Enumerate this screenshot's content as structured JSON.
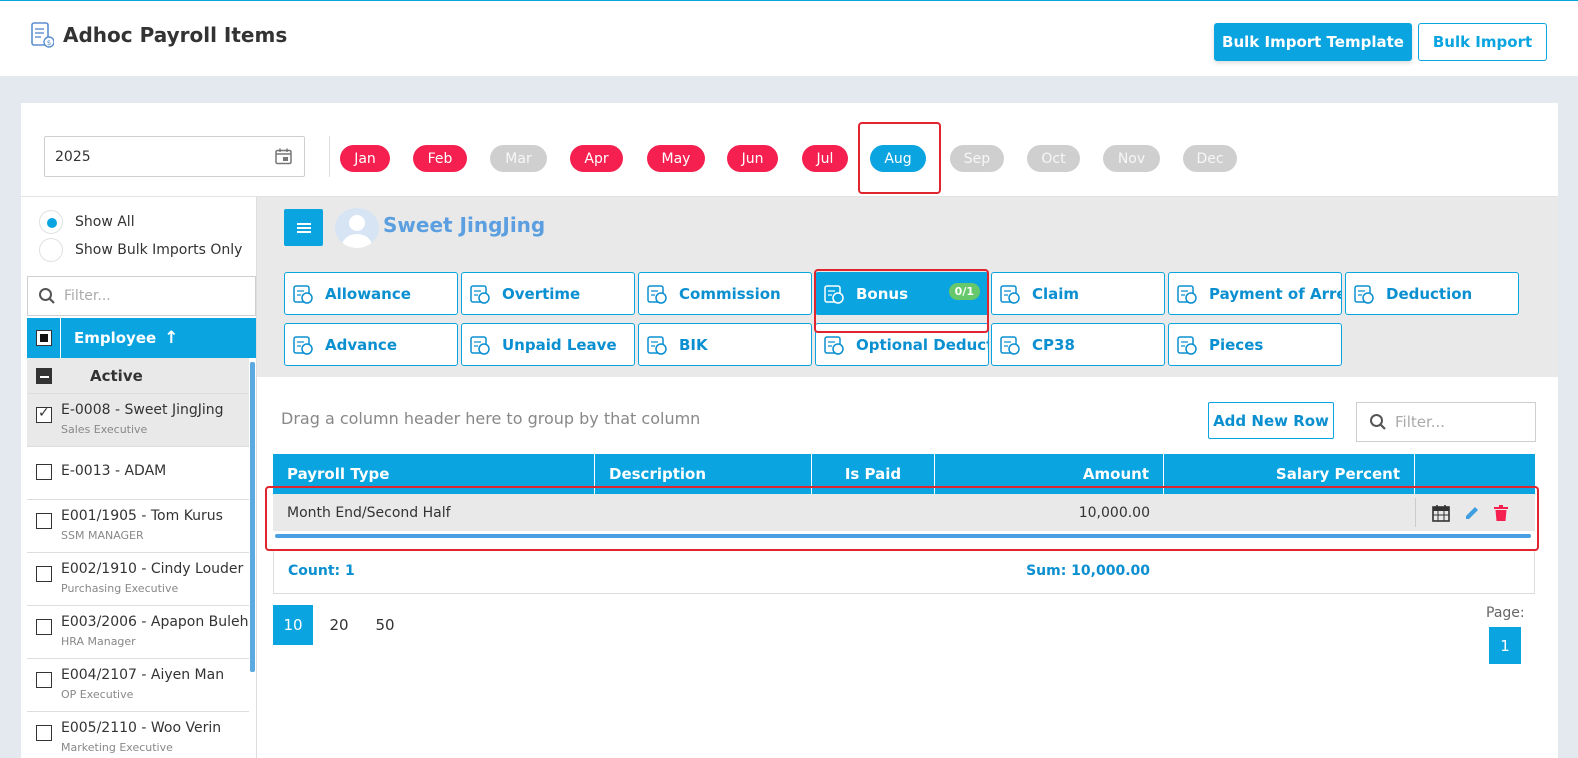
{
  "header": {
    "title": "Adhoc Payroll Items",
    "bulk_template_label": "Bulk Import Template",
    "bulk_import_label": "Bulk Import"
  },
  "year": {
    "value": "2025"
  },
  "months": [
    {
      "label": "Jan",
      "state": "red"
    },
    {
      "label": "Feb",
      "state": "red"
    },
    {
      "label": "Mar",
      "state": "gray"
    },
    {
      "label": "Apr",
      "state": "red"
    },
    {
      "label": "May",
      "state": "red"
    },
    {
      "label": "Jun",
      "state": "red"
    },
    {
      "label": "Jul",
      "state": "red"
    },
    {
      "label": "Aug",
      "state": "selected"
    },
    {
      "label": "Sep",
      "state": "gray"
    },
    {
      "label": "Oct",
      "state": "gray"
    },
    {
      "label": "Nov",
      "state": "gray"
    },
    {
      "label": "Dec",
      "state": "gray"
    }
  ],
  "left": {
    "show_all": "Show All",
    "show_bulk": "Show Bulk Imports Only",
    "filter_placeholder": "Filter...",
    "employee_header": "Employee",
    "sort_arrow": "↑",
    "group_label": "Active",
    "employees": [
      {
        "name": "E-0008 - Sweet JingJing",
        "role": "Sales Executive",
        "checked": true
      },
      {
        "name": "E-0013 - ADAM",
        "role": "",
        "checked": false
      },
      {
        "name": "E001/1905 - Tom Kurus",
        "role": "SSM MANAGER",
        "checked": false
      },
      {
        "name": "E002/1910 - Cindy Louder",
        "role": "Purchasing Executive",
        "checked": false
      },
      {
        "name": "E003/2006 - Apapon Buleh",
        "role": "HRA Manager",
        "checked": false
      },
      {
        "name": "E004/2107 - Aiyen Man",
        "role": "OP Executive",
        "checked": false
      },
      {
        "name": "E005/2110 - Woo Verin",
        "role": "Marketing Executive",
        "checked": false
      }
    ]
  },
  "employee": {
    "name": "Sweet JingJing"
  },
  "categories": [
    {
      "label": "Allowance",
      "icon": "allowance-icon"
    },
    {
      "label": "Overtime",
      "icon": "clock-icon"
    },
    {
      "label": "Commission",
      "icon": "commission-icon"
    },
    {
      "label": "Bonus",
      "icon": "bonus-icon",
      "badge": "0/1"
    },
    {
      "label": "Claim",
      "icon": "claim-icon"
    },
    {
      "label": "Payment of Arre...",
      "icon": "arrears-icon"
    },
    {
      "label": "Deduction",
      "icon": "deduction-icon"
    },
    {
      "label": "Advance",
      "icon": "advance-icon"
    },
    {
      "label": "Unpaid Leave",
      "icon": "calendar-icon"
    },
    {
      "label": "BIK",
      "icon": "bik-icon"
    },
    {
      "label": "Optional Deduct...",
      "icon": "optional-deduction-icon"
    },
    {
      "label": "CP38",
      "icon": "cp38-icon"
    },
    {
      "label": "Pieces",
      "icon": "pieces-icon"
    }
  ],
  "grid": {
    "group_hint": "Drag a column header here to group by that column",
    "add_row_label": "Add New Row",
    "filter_placeholder": "Filter...",
    "columns": [
      "Payroll Type",
      "Description",
      "Is Paid",
      "Amount",
      "Salary Percent"
    ],
    "rows": [
      {
        "payroll_type": "Month End/Second Half",
        "description": "",
        "is_paid": "",
        "amount": "10,000.00",
        "salary_percent": ""
      }
    ],
    "count_label": "Count: 1",
    "sum_label": "Sum: 10,000.00"
  },
  "pager": {
    "sizes": [
      "10",
      "20",
      "50"
    ],
    "page_label": "Page:",
    "current_page": "1"
  },
  "colors": {
    "accent": "#0aa4e0",
    "month_active": "#f5204f",
    "month_inactive": "#cfcfcf",
    "highlight": "#e0252f"
  }
}
